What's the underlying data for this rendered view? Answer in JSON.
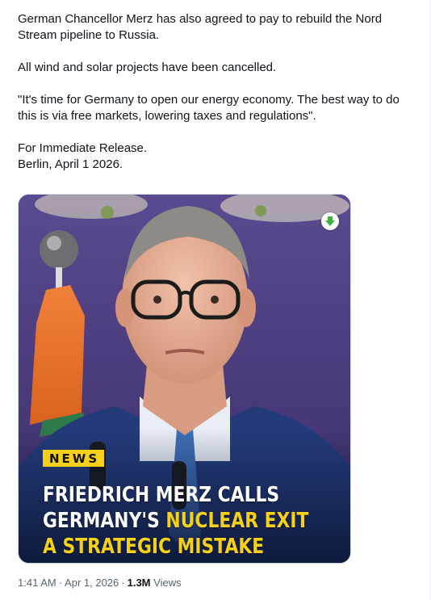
{
  "tweet": {
    "paragraphs": [
      [
        "German Chancellor Merz has also agreed to pay to rebuild the Nord Stream pipeline to Russia."
      ],
      [
        "All wind and solar projects have been cancelled."
      ],
      [
        "\"It's time for Germany to open our energy economy. The best way to do this is via free markets, lowering taxes and regulations\"."
      ],
      [
        "For Immediate Release.",
        "Berlin, April 1 2026."
      ]
    ]
  },
  "media": {
    "tag": "NEWS",
    "headline_line1": "FRIEDRICH MERZ CALLS",
    "headline_line2_white": "GERMANY'S ",
    "headline_line2_yellow": "NUCLEAR EXIT",
    "headline_line3": "A STRATEGIC MISTAKE",
    "badge_icon": "download-arrow-icon",
    "colors": {
      "tag_bg": "#f7d117",
      "highlight": "#f7d117",
      "background": "#4a3a78"
    }
  },
  "meta": {
    "time": "1:41 AM",
    "date": "Apr 1, 2026",
    "views_count": "1.3M",
    "views_label": "Views"
  }
}
